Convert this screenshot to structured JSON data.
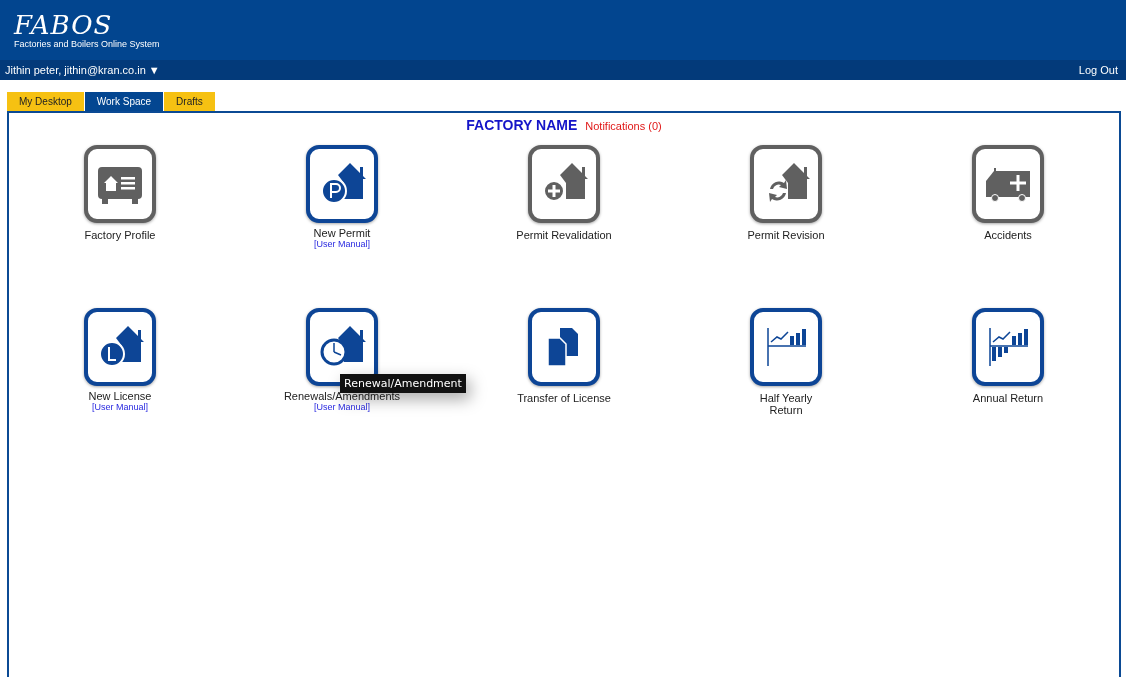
{
  "header": {
    "logo": "FABOS",
    "subtitle": "Factories and Boilers Online System"
  },
  "user_bar": {
    "user": "Jithin peter, jithin@kran.co.in",
    "caret": "▼",
    "logout": "Log Out"
  },
  "tabs": [
    {
      "label": "My Desktop",
      "selected": false
    },
    {
      "label": "Work Space",
      "selected": true
    },
    {
      "label": "Drafts",
      "selected": false
    }
  ],
  "panel": {
    "title": "FACTORY NAME",
    "notifications": "Notifications (0)"
  },
  "tiles": [
    {
      "label": "Factory Profile",
      "kind": "profile",
      "enabled": false
    },
    {
      "label": "New Permit",
      "kind": "permit",
      "enabled": true,
      "link": "[User Manual]"
    },
    {
      "label": "Permit Revalidation",
      "kind": "revalidation",
      "enabled": false
    },
    {
      "label": "Permit Revision",
      "kind": "revision",
      "enabled": false
    },
    {
      "label": "Accidents",
      "kind": "ambulance",
      "enabled": false
    },
    {
      "label": "New License",
      "kind": "license",
      "enabled": true,
      "link": "[User Manual]"
    },
    {
      "label": "Renewals/Amendments",
      "kind": "renewal",
      "enabled": true,
      "link": "[User Manual]",
      "tooltip": "Renewal/Amendment"
    },
    {
      "label": "Transfer of License",
      "kind": "documents",
      "enabled": true
    },
    {
      "label": "Half Yearly Return",
      "kind": "chart",
      "enabled": true
    },
    {
      "label": "Annual Return",
      "kind": "chart2",
      "enabled": true
    }
  ]
}
